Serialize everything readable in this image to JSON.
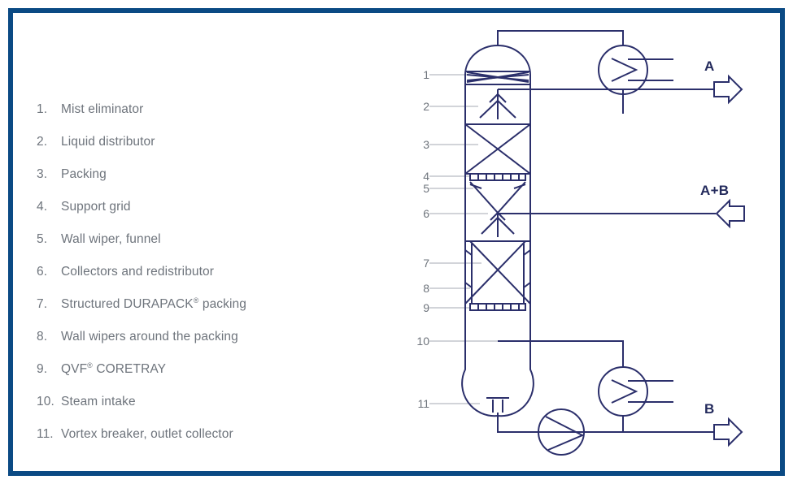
{
  "frame": {
    "border_color": "#0b4a84",
    "background": "#ffffff"
  },
  "legend": {
    "text_color": "#6e747c",
    "items": [
      {
        "num": "1.",
        "label": "Mist eliminator"
      },
      {
        "num": "2.",
        "label": "Liquid distributor"
      },
      {
        "num": "3.",
        "label": "Packing"
      },
      {
        "num": "4.",
        "label": "Support grid"
      },
      {
        "num": "5.",
        "label": "Wall wiper, funnel"
      },
      {
        "num": "6.",
        "label": "Collectors and redistributor"
      },
      {
        "num": "7.",
        "label": "Structured DURAPACK® packing"
      },
      {
        "num": "8.",
        "label": "Wall wipers around the packing"
      },
      {
        "num": "9.",
        "label": "QVF® CORETRAY"
      },
      {
        "num": "10.",
        "label": "Steam intake"
      },
      {
        "num": "11.",
        "label": "Vortex breaker, outlet collector"
      }
    ]
  },
  "diagram": {
    "line_color": "#2b2f6b",
    "leader_color": "#b7bbc2",
    "callout_color": "#6e747c",
    "callouts": [
      {
        "id": "1",
        "label": "1"
      },
      {
        "id": "2",
        "label": "2"
      },
      {
        "id": "3",
        "label": "3"
      },
      {
        "id": "4",
        "label": "4"
      },
      {
        "id": "5",
        "label": "5"
      },
      {
        "id": "6",
        "label": "6"
      },
      {
        "id": "7",
        "label": "7"
      },
      {
        "id": "8",
        "label": "8"
      },
      {
        "id": "9",
        "label": "9"
      },
      {
        "id": "10",
        "label": "10"
      },
      {
        "id": "11",
        "label": "11"
      }
    ],
    "streams": [
      {
        "id": "top-product",
        "label": "A",
        "direction": "out"
      },
      {
        "id": "feed",
        "label": "A+B",
        "direction": "in"
      },
      {
        "id": "bottom-product",
        "label": "B",
        "direction": "out"
      }
    ],
    "equipment": [
      {
        "id": "condenser",
        "name": "heat-exchanger"
      },
      {
        "id": "reboiler",
        "name": "heat-exchanger"
      },
      {
        "id": "bottoms-pump",
        "name": "pump"
      }
    ]
  }
}
